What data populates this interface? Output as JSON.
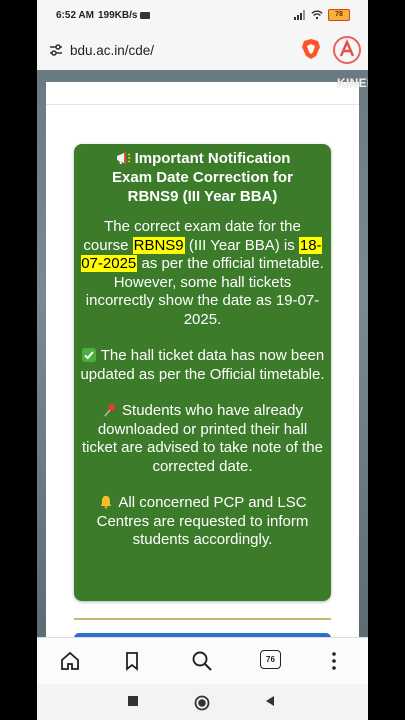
{
  "status_bar": {
    "time": "6:52 AM",
    "speed": "199KB/s",
    "battery": "78"
  },
  "browser": {
    "url": "bdu.ac.in/cde/",
    "tabs_count": "76"
  },
  "watermark": "KINEMASTER",
  "notice": {
    "title_line1": "Important Notification",
    "title_line2": "Exam Date Correction for",
    "title_line3": "RBNS9 (III Year BBA)",
    "p1_before": "The correct exam date for the course ",
    "p1_course": "RBNS9",
    "p1_mid": " (III Year BBA) is ",
    "p1_date": "18-07-2025",
    "p1_after": " as per the official timetable.",
    "p2": "However, some hall tickets incorrectly show the date as 19-07-2025.",
    "p3": "The hall ticket data has now been updated as per the Official timetable.",
    "p4": "Students who have already downloaded or printed their hall ticket are advised to take note of the corrected date.",
    "p5": "All concerned PCP and LSC Centres are requested to inform students accordingly."
  },
  "icons": {
    "megaphone": "megaphone-icon",
    "check": "check-mark-icon",
    "pin": "pushpin-icon",
    "bell": "bell-icon"
  },
  "colors": {
    "card_green": "#3c7b2a",
    "highlight": "#ffff00",
    "brand_blue": "#2c6fd1"
  }
}
